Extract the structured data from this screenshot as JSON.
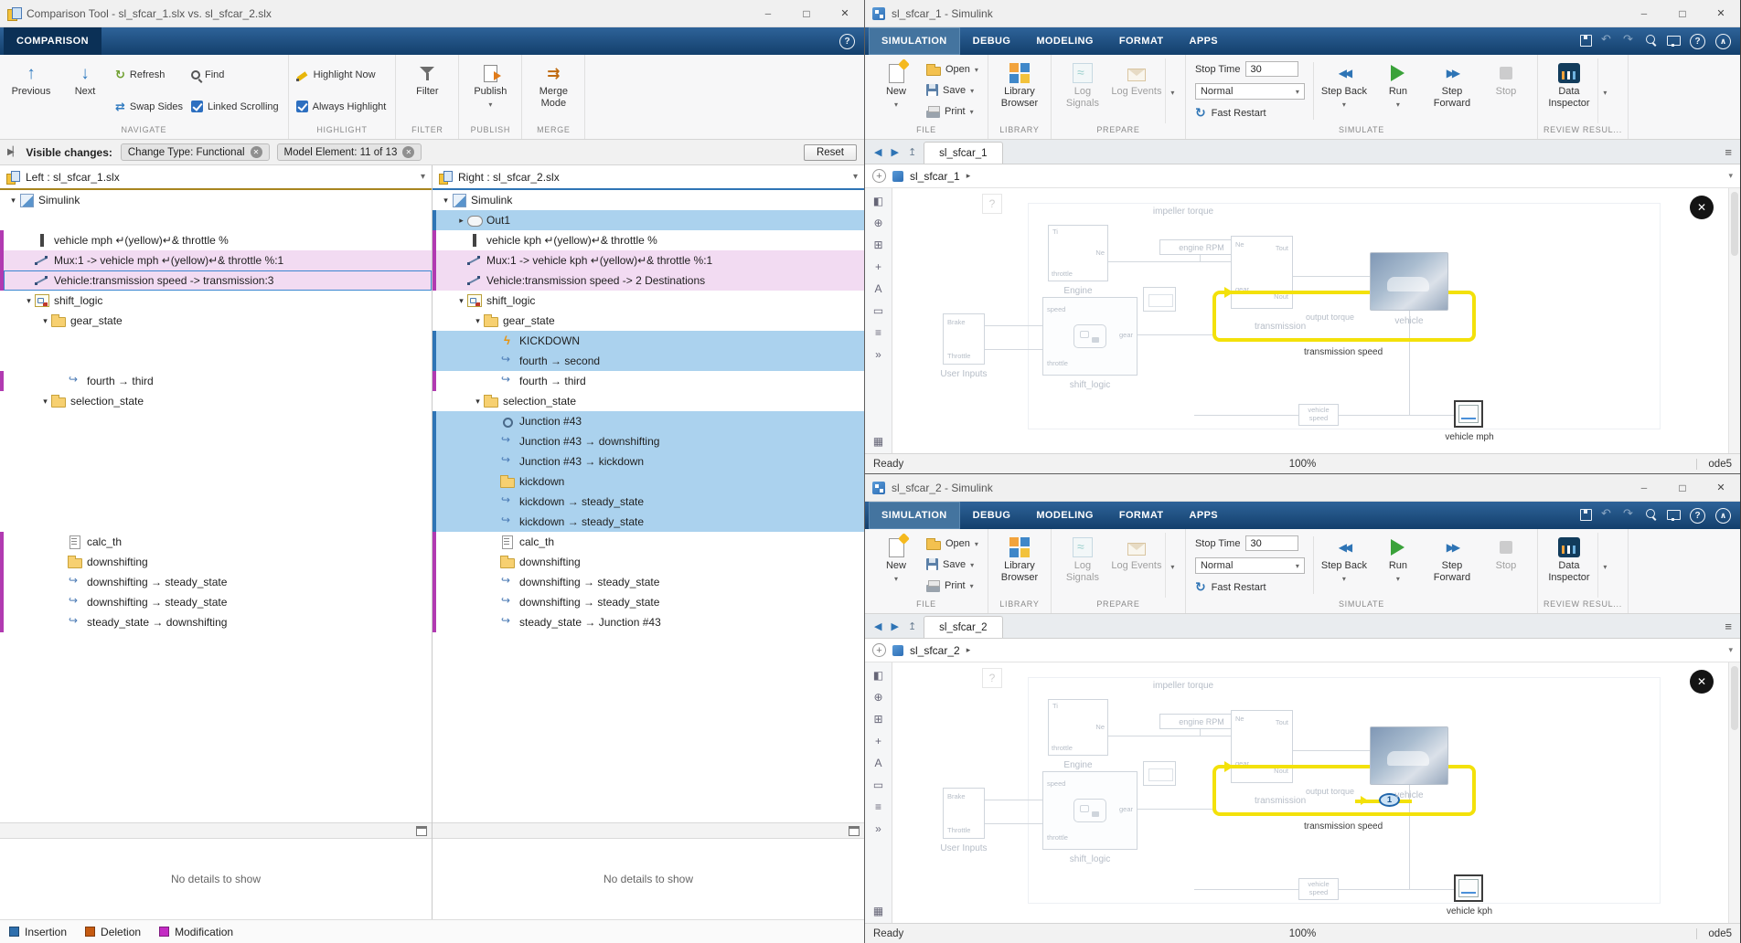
{
  "comparison": {
    "window_title": "Comparison Tool - sl_sfcar_1.slx vs. sl_sfcar_2.slx",
    "tab_label": "COMPARISON",
    "toolbar": {
      "previous": "Previous",
      "next": "Next",
      "refresh": "Refresh",
      "swap_sides": "Swap Sides",
      "find": "Find",
      "linked_scrolling": "Linked Scrolling",
      "highlight_now": "Highlight Now",
      "always_highlight": "Always Highlight",
      "filter": "Filter",
      "publish": "Publish",
      "merge_mode": "Merge Mode",
      "sections": {
        "navigate": "NAVIGATE",
        "highlight": "HIGHLIGHT",
        "filter": "FILTER",
        "publish": "PUBLISH",
        "merge": "MERGE"
      }
    },
    "filter_bar": {
      "label": "Visible changes:",
      "chips": [
        {
          "text": "Change Type: Functional"
        },
        {
          "text": "Model Element: 11 of 13"
        }
      ],
      "reset": "Reset"
    },
    "left_pane": {
      "header": "Left : sl_sfcar_1.slx",
      "details": "No details to show",
      "rows": [
        {
          "t": "row",
          "lv": "0",
          "exp": "open",
          "icon": "simulink",
          "label": "Simulink"
        },
        {
          "t": "spacer"
        },
        {
          "t": "row",
          "lv": "1",
          "icon": "mux",
          "label": "vehicle mph ↵(yellow)↵& throttle %",
          "mk": "m"
        },
        {
          "t": "row",
          "lv": "1",
          "icon": "signal",
          "label": "Mux:1 -> vehicle mph ↵(yellow)↵& throttle %:1",
          "st": "mod",
          "mk": "m"
        },
        {
          "t": "row",
          "lv": "1",
          "icon": "signal",
          "label": "Vehicle:transmission speed -> transmission:3",
          "st": "mod sel",
          "mk": "m"
        },
        {
          "t": "row",
          "lv": "1",
          "exp": "open",
          "icon": "chart",
          "label": "shift_logic"
        },
        {
          "t": "row",
          "lv": "2",
          "exp": "open",
          "icon": "folder",
          "label": "gear_state"
        },
        {
          "t": "spacer"
        },
        {
          "t": "spacer"
        },
        {
          "t": "row",
          "lv": "3",
          "icon": "transition",
          "label": "fourth → third",
          "mk": "m"
        },
        {
          "t": "row",
          "lv": "2",
          "exp": "open",
          "icon": "folder",
          "label": "selection_state"
        },
        {
          "t": "spacer"
        },
        {
          "t": "spacer"
        },
        {
          "t": "spacer"
        },
        {
          "t": "spacer"
        },
        {
          "t": "spacer"
        },
        {
          "t": "spacer"
        },
        {
          "t": "row",
          "lv": "3",
          "icon": "calc",
          "label": "calc_th",
          "mk": "m"
        },
        {
          "t": "row",
          "lv": "3",
          "icon": "folder",
          "label": "downshifting",
          "mk": "m"
        },
        {
          "t": "row",
          "lv": "3",
          "icon": "transition",
          "label": "downshifting → steady_state",
          "mk": "m"
        },
        {
          "t": "row",
          "lv": "3",
          "icon": "transition",
          "label": "downshifting → steady_state",
          "mk": "m"
        },
        {
          "t": "row",
          "lv": "3",
          "icon": "transition",
          "label": "steady_state → downshifting",
          "mk": "m"
        }
      ]
    },
    "right_pane": {
      "header": "Right : sl_sfcar_2.slx",
      "details": "No details to show",
      "rows": [
        {
          "t": "row",
          "lv": "0",
          "exp": "open",
          "icon": "simulink",
          "label": "Simulink"
        },
        {
          "t": "row",
          "lv": "1",
          "exp": "closed",
          "icon": "outport",
          "label": "Out1",
          "st": "ins",
          "mk": "b"
        },
        {
          "t": "row",
          "lv": "1",
          "icon": "mux",
          "label": "vehicle kph ↵(yellow)↵& throttle %",
          "mk": "m"
        },
        {
          "t": "row",
          "lv": "1",
          "icon": "signal",
          "label": "Mux:1 -> vehicle kph ↵(yellow)↵& throttle %:1",
          "st": "mod",
          "mk": "m"
        },
        {
          "t": "row",
          "lv": "1",
          "icon": "signal",
          "label": "Vehicle:transmission speed -> 2 Destinations",
          "st": "mod",
          "mk": "m"
        },
        {
          "t": "row",
          "lv": "1",
          "exp": "open",
          "icon": "chart",
          "label": "shift_logic"
        },
        {
          "t": "row",
          "lv": "2",
          "exp": "open",
          "icon": "folder",
          "label": "gear_state"
        },
        {
          "t": "row",
          "lv": "3",
          "icon": "event",
          "label": "KICKDOWN",
          "st": "ins",
          "mk": "b"
        },
        {
          "t": "row",
          "lv": "3",
          "icon": "transition",
          "label": "fourth → second",
          "st": "ins",
          "mk": "b"
        },
        {
          "t": "row",
          "lv": "3",
          "icon": "transition",
          "label": "fourth → third",
          "mk": "m"
        },
        {
          "t": "row",
          "lv": "2",
          "exp": "open",
          "icon": "folder",
          "label": "selection_state"
        },
        {
          "t": "row",
          "lv": "3",
          "icon": "junction",
          "label": "Junction #43",
          "st": "ins",
          "mk": "b"
        },
        {
          "t": "row",
          "lv": "3",
          "icon": "transition",
          "label": "Junction #43 → downshifting",
          "st": "ins",
          "mk": "b"
        },
        {
          "t": "row",
          "lv": "3",
          "icon": "transition",
          "label": "Junction #43 → kickdown",
          "st": "ins",
          "mk": "b"
        },
        {
          "t": "row",
          "lv": "3",
          "icon": "folder",
          "label": "kickdown",
          "st": "ins",
          "mk": "b"
        },
        {
          "t": "row",
          "lv": "3",
          "icon": "transition",
          "label": "kickdown → steady_state",
          "st": "ins",
          "mk": "b"
        },
        {
          "t": "row",
          "lv": "3",
          "icon": "transition",
          "label": "kickdown → steady_state",
          "st": "ins",
          "mk": "b"
        },
        {
          "t": "row",
          "lv": "3",
          "icon": "calc",
          "label": "calc_th",
          "mk": "m"
        },
        {
          "t": "row",
          "lv": "3",
          "icon": "folder",
          "label": "downshifting",
          "mk": "m"
        },
        {
          "t": "row",
          "lv": "3",
          "icon": "transition",
          "label": "downshifting → steady_state",
          "mk": "m"
        },
        {
          "t": "row",
          "lv": "3",
          "icon": "transition",
          "label": "downshifting → steady_state",
          "mk": "m"
        },
        {
          "t": "row",
          "lv": "3",
          "icon": "transition",
          "label": "steady_state → Junction #43",
          "mk": "m"
        }
      ]
    },
    "legend": [
      {
        "label": "Insertion",
        "color": "#2e6fad"
      },
      {
        "label": "Deletion",
        "color": "#c55a11"
      },
      {
        "label": "Modification",
        "color": "#c32ac3"
      }
    ]
  },
  "sim": {
    "tabs": [
      {
        "label": "SIMULATION",
        "state": "sel"
      },
      {
        "label": "DEBUG"
      },
      {
        "label": "MODELING"
      },
      {
        "label": "FORMAT"
      },
      {
        "label": "APPS"
      }
    ],
    "qat": [
      {
        "icon": "save",
        "name": "save-icon"
      },
      {
        "icon": "undo",
        "dim": "1",
        "name": "undo-icon"
      },
      {
        "icon": "redo",
        "dim": "1",
        "name": "redo-icon"
      },
      {
        "icon": "search",
        "name": "search-icon"
      },
      {
        "icon": "monitor",
        "name": "screen-icon"
      }
    ],
    "ribbon": {
      "new": "New",
      "open": "Open",
      "save": "Save",
      "print": "Print",
      "library_browser": "Library Browser",
      "log_signals": "Log Signals",
      "log_events": "Log Events",
      "stop_time_label": "Stop Time",
      "stop_time_value": "30",
      "mode": "Normal",
      "fast_restart": "Fast Restart",
      "step_back": "Step Back",
      "run": "Run",
      "step_forward": "Step Forward",
      "stop": "Stop",
      "data_inspector": "Data Inspector",
      "sections": {
        "file": "FILE",
        "library": "LIBRARY",
        "prepare": "PREPARE",
        "simulate": "SIMULATE",
        "review": "REVIEW RESUL..."
      }
    },
    "status": {
      "ready": "Ready",
      "zoom": "100%",
      "solver": "ode5"
    },
    "palette": [
      {
        "name": "hide-browser-icon",
        "glyph": "◧"
      },
      {
        "name": "zoom-icon",
        "glyph": "⊕"
      },
      {
        "name": "fit-view-icon",
        "glyph": "⊞"
      },
      {
        "name": "pan-icon",
        "glyph": "+"
      },
      {
        "name": "annotation-icon",
        "glyph": "A"
      },
      {
        "name": "area-icon",
        "glyph": "▭"
      },
      {
        "name": "signal-lines-icon",
        "glyph": "≡"
      },
      {
        "name": "more-tools-icon",
        "glyph": "»"
      },
      {
        "name": "model-browser-icon",
        "glyph": "▦"
      }
    ],
    "diagram": {
      "help": "?",
      "impeller_torque": "impeller torque",
      "engine": "Engine",
      "engine_rpm": "engine RPM",
      "transmission": "transmission",
      "transmission_speed": "transmission speed",
      "output_torque": "output torque",
      "vehicle": "vehicle",
      "vehicle_speed": "vehicle speed",
      "user_inputs": "User Inputs",
      "brake": "Brake",
      "throttle": "throttle",
      "throttle_cap": "Throttle",
      "shift_logic": "shift_logic",
      "speed": "speed",
      "gear": "gear",
      "ti": "Ti",
      "ne": "Ne",
      "nout": "Nout",
      "tout": "Tout"
    }
  },
  "windows": [
    {
      "title": "sl_sfcar_1 - Simulink",
      "doc_tab": "sl_sfcar_1",
      "breadcrumb": "sl_sfcar_1",
      "scope_label": "vehicle mph"
    },
    {
      "title": "sl_sfcar_2 - Simulink",
      "doc_tab": "sl_sfcar_2",
      "breadcrumb": "sl_sfcar_2",
      "scope_label": "vehicle kph",
      "badge": "1"
    }
  ]
}
